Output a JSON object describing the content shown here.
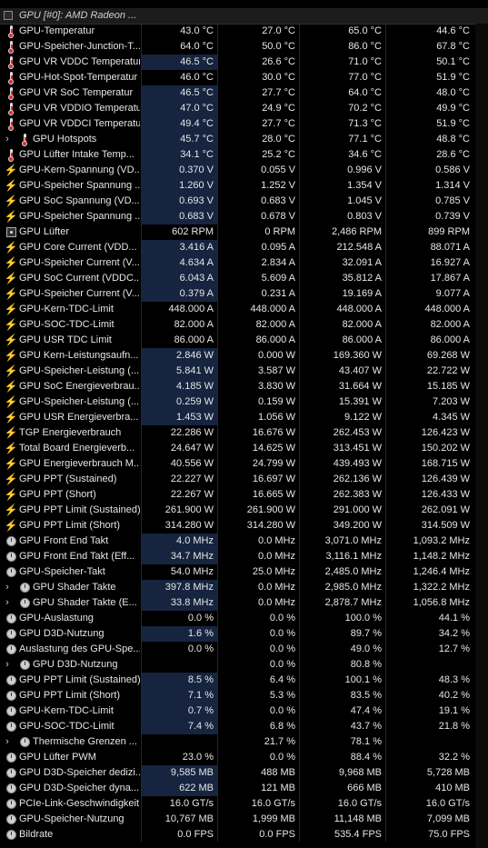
{
  "header": {
    "title": "GPU [#0]: AMD Radeon ..."
  },
  "rows": [
    {
      "icon": "thermometer",
      "name": "GPU-Temperatur",
      "v": [
        "43.0 °C",
        "27.0 °C",
        "65.0 °C",
        "44.6 °C"
      ],
      "hl": false
    },
    {
      "icon": "thermometer",
      "name": "GPU-Speicher-Junction-T...",
      "v": [
        "64.0 °C",
        "50.0 °C",
        "86.0 °C",
        "67.8 °C"
      ],
      "hl": false
    },
    {
      "icon": "thermometer",
      "name": "GPU VR VDDC Temperatur",
      "v": [
        "46.5 °C",
        "26.6 °C",
        "71.0 °C",
        "50.1 °C"
      ],
      "hl": true
    },
    {
      "icon": "thermometer",
      "name": "GPU-Hot-Spot-Temperatur",
      "v": [
        "46.0 °C",
        "30.0 °C",
        "77.0 °C",
        "51.9 °C"
      ],
      "hl": false
    },
    {
      "icon": "thermometer",
      "name": "GPU VR SoC Temperatur",
      "v": [
        "46.5 °C",
        "27.7 °C",
        "64.0 °C",
        "48.0 °C"
      ],
      "hl": true
    },
    {
      "icon": "thermometer",
      "name": "GPU VR VDDIO Temperatur",
      "v": [
        "47.0 °C",
        "24.9 °C",
        "70.2 °C",
        "49.9 °C"
      ],
      "hl": true
    },
    {
      "icon": "thermometer",
      "name": "GPU VR VDDCI Temperatur",
      "v": [
        "49.4 °C",
        "27.7 °C",
        "71.3 °C",
        "51.9 °C"
      ],
      "hl": true
    },
    {
      "icon": "thermometer",
      "expand": true,
      "indent": true,
      "name": "GPU Hotspots",
      "v": [
        "45.7 °C",
        "28.0 °C",
        "77.1 °C",
        "48.8 °C"
      ],
      "hl": true
    },
    {
      "icon": "thermometer",
      "name": "GPU Lüfter Intake Temp...",
      "v": [
        "34.1 °C",
        "25.2 °C",
        "34.6 °C",
        "28.6 °C"
      ],
      "hl": true
    },
    {
      "icon": "bolt",
      "name": "GPU-Kern-Spannung (VD...",
      "v": [
        "0.370 V",
        "0.055 V",
        "0.996 V",
        "0.586 V"
      ],
      "hl": true
    },
    {
      "icon": "bolt",
      "name": "GPU-Speicher Spannung ...",
      "v": [
        "1.260 V",
        "1.252 V",
        "1.354 V",
        "1.314 V"
      ],
      "hl": true
    },
    {
      "icon": "bolt",
      "name": "GPU SoC Spannung (VD...",
      "v": [
        "0.693 V",
        "0.683 V",
        "1.045 V",
        "0.785 V"
      ],
      "hl": true
    },
    {
      "icon": "bolt",
      "name": "GPU-Speicher Spannung ...",
      "v": [
        "0.683 V",
        "0.678 V",
        "0.803 V",
        "0.739 V"
      ],
      "hl": true
    },
    {
      "icon": "fan",
      "name": "GPU Lüfter",
      "v": [
        "602 RPM",
        "0 RPM",
        "2,486 RPM",
        "899 RPM"
      ],
      "hl": false
    },
    {
      "icon": "bolt",
      "name": "GPU Core Current (VDD...",
      "v": [
        "3.416 A",
        "0.095 A",
        "212.548 A",
        "88.071 A"
      ],
      "hl": true
    },
    {
      "icon": "bolt",
      "name": "GPU-Speicher Current (V...",
      "v": [
        "4.634 A",
        "2.834 A",
        "32.091 A",
        "16.927 A"
      ],
      "hl": true
    },
    {
      "icon": "bolt",
      "name": "GPU SoC Current (VDDC...",
      "v": [
        "6.043 A",
        "5.609 A",
        "35.812 A",
        "17.867 A"
      ],
      "hl": true
    },
    {
      "icon": "bolt",
      "name": "GPU-Speicher Current (V...",
      "v": [
        "0.379 A",
        "0.231 A",
        "19.169 A",
        "9.077 A"
      ],
      "hl": true
    },
    {
      "icon": "bolt",
      "name": "GPU-Kern-TDC-Limit",
      "v": [
        "448.000 A",
        "448.000 A",
        "448.000 A",
        "448.000 A"
      ],
      "hl": false
    },
    {
      "icon": "bolt",
      "name": "GPU-SOC-TDC-Limit",
      "v": [
        "82.000 A",
        "82.000 A",
        "82.000 A",
        "82.000 A"
      ],
      "hl": false
    },
    {
      "icon": "bolt",
      "name": "GPU USR TDC Limit",
      "v": [
        "86.000 A",
        "86.000 A",
        "86.000 A",
        "86.000 A"
      ],
      "hl": false
    },
    {
      "icon": "bolt",
      "name": "GPU Kern-Leistungsaufn...",
      "v": [
        "2.846 W",
        "0.000 W",
        "169.360 W",
        "69.268 W"
      ],
      "hl": true
    },
    {
      "icon": "bolt",
      "name": "GPU-Speicher-Leistung (...",
      "v": [
        "5.841 W",
        "3.587 W",
        "43.407 W",
        "22.722 W"
      ],
      "hl": true
    },
    {
      "icon": "bolt",
      "name": "GPU SoC Energieverbrau...",
      "v": [
        "4.185 W",
        "3.830 W",
        "31.664 W",
        "15.185 W"
      ],
      "hl": true
    },
    {
      "icon": "bolt",
      "name": "GPU-Speicher-Leistung (...",
      "v": [
        "0.259 W",
        "0.159 W",
        "15.391 W",
        "7.203 W"
      ],
      "hl": true
    },
    {
      "icon": "bolt",
      "name": "GPU USR Energieverbra...",
      "v": [
        "1.453 W",
        "1.056 W",
        "9.122 W",
        "4.345 W"
      ],
      "hl": true
    },
    {
      "icon": "bolt",
      "name": "TGP Energieverbrauch",
      "v": [
        "22.286 W",
        "16.676 W",
        "262.453 W",
        "126.423 W"
      ],
      "hl": false
    },
    {
      "icon": "bolt",
      "name": "Total Board Energieverb...",
      "v": [
        "24.647 W",
        "14.625 W",
        "313.451 W",
        "150.202 W"
      ],
      "hl": false
    },
    {
      "icon": "bolt",
      "name": "GPU Energieverbrauch M...",
      "v": [
        "40.556 W",
        "24.799 W",
        "439.493 W",
        "168.715 W"
      ],
      "hl": false
    },
    {
      "icon": "bolt",
      "name": "GPU PPT (Sustained)",
      "v": [
        "22.227 W",
        "16.697 W",
        "262.136 W",
        "126.439 W"
      ],
      "hl": false
    },
    {
      "icon": "bolt",
      "name": "GPU PPT (Short)",
      "v": [
        "22.267 W",
        "16.665 W",
        "262.383 W",
        "126.433 W"
      ],
      "hl": false
    },
    {
      "icon": "bolt",
      "name": "GPU PPT Limit (Sustained)",
      "v": [
        "261.900 W",
        "261.900 W",
        "291.000 W",
        "262.091 W"
      ],
      "hl": false
    },
    {
      "icon": "bolt",
      "name": "GPU PPT Limit (Short)",
      "v": [
        "314.280 W",
        "314.280 W",
        "349.200 W",
        "314.509 W"
      ],
      "hl": false
    },
    {
      "icon": "clock",
      "name": "GPU Front End Takt",
      "v": [
        "4.0 MHz",
        "0.0 MHz",
        "3,071.0 MHz",
        "1,093.2 MHz"
      ],
      "hl": true
    },
    {
      "icon": "clock",
      "name": "GPU Front End Takt (Eff...",
      "v": [
        "34.7 MHz",
        "0.0 MHz",
        "3,116.1 MHz",
        "1,148.2 MHz"
      ],
      "hl": true
    },
    {
      "icon": "clock",
      "name": "GPU-Speicher-Takt",
      "v": [
        "54.0 MHz",
        "25.0 MHz",
        "2,485.0 MHz",
        "1,246.4 MHz"
      ],
      "hl": false
    },
    {
      "icon": "clock",
      "expand": true,
      "indent": true,
      "name": "GPU Shader Takte",
      "v": [
        "397.8 MHz",
        "0.0 MHz",
        "2,985.0 MHz",
        "1,322.2 MHz"
      ],
      "hl": true
    },
    {
      "icon": "clock",
      "expand": true,
      "indent": true,
      "name": "GPU Shader Takte (E...",
      "v": [
        "33.8 MHz",
        "0.0 MHz",
        "2,878.7 MHz",
        "1,056.8 MHz"
      ],
      "hl": true
    },
    {
      "icon": "clock",
      "name": "GPU-Auslastung",
      "v": [
        "0.0 %",
        "0.0 %",
        "100.0 %",
        "44.1 %"
      ],
      "hl": false
    },
    {
      "icon": "clock",
      "name": "GPU D3D-Nutzung",
      "v": [
        "1.6 %",
        "0.0 %",
        "89.7 %",
        "34.2 %"
      ],
      "hl": true
    },
    {
      "icon": "clock",
      "name": "Auslastung des GPU-Spe...",
      "v": [
        "0.0 %",
        "0.0 %",
        "49.0 %",
        "12.7 %"
      ],
      "hl": false
    },
    {
      "icon": "clock",
      "expand": true,
      "indent": true,
      "name": "GPU D3D-Nutzung",
      "v": [
        "",
        "0.0 %",
        "80.8 %",
        ""
      ],
      "hl": false
    },
    {
      "icon": "clock",
      "name": "GPU PPT Limit (Sustained)",
      "v": [
        "8.5 %",
        "6.4 %",
        "100.1 %",
        "48.3 %"
      ],
      "hl": true
    },
    {
      "icon": "clock",
      "name": "GPU PPT Limit (Short)",
      "v": [
        "7.1 %",
        "5.3 %",
        "83.5 %",
        "40.2 %"
      ],
      "hl": true
    },
    {
      "icon": "clock",
      "name": "GPU-Kern-TDC-Limit",
      "v": [
        "0.7 %",
        "0.0 %",
        "47.4 %",
        "19.1 %"
      ],
      "hl": true
    },
    {
      "icon": "clock",
      "name": "GPU-SOC-TDC-Limit",
      "v": [
        "7.4 %",
        "6.8 %",
        "43.7 %",
        "21.8 %"
      ],
      "hl": true
    },
    {
      "icon": "clock",
      "expand": true,
      "indent": true,
      "name": "Thermische Grenzen ...",
      "v": [
        "",
        "21.7 %",
        "78.1 %",
        ""
      ],
      "hl": false
    },
    {
      "icon": "clock",
      "name": "GPU Lüfter PWM",
      "v": [
        "23.0 %",
        "0.0 %",
        "88.4 %",
        "32.2 %"
      ],
      "hl": false
    },
    {
      "icon": "clock",
      "name": "GPU D3D-Speicher dedizi...",
      "v": [
        "9,585 MB",
        "488 MB",
        "9,968 MB",
        "5,728 MB"
      ],
      "hl": true
    },
    {
      "icon": "clock",
      "name": "GPU D3D-Speicher dyna...",
      "v": [
        "622 MB",
        "121 MB",
        "666 MB",
        "410 MB"
      ],
      "hl": true
    },
    {
      "icon": "clock",
      "name": "PCIe-Link-Geschwindigkeit",
      "v": [
        "16.0 GT/s",
        "16.0 GT/s",
        "16.0 GT/s",
        "16.0 GT/s"
      ],
      "hl": false
    },
    {
      "icon": "clock",
      "name": "GPU-Speicher-Nutzung",
      "v": [
        "10,767 MB",
        "1,999 MB",
        "11,148 MB",
        "7,099 MB"
      ],
      "hl": false
    },
    {
      "icon": "clock",
      "name": "Bildrate",
      "v": [
        "0.0 FPS",
        "0.0 FPS",
        "535.4 FPS",
        "75.0 FPS"
      ],
      "hl": false
    }
  ]
}
